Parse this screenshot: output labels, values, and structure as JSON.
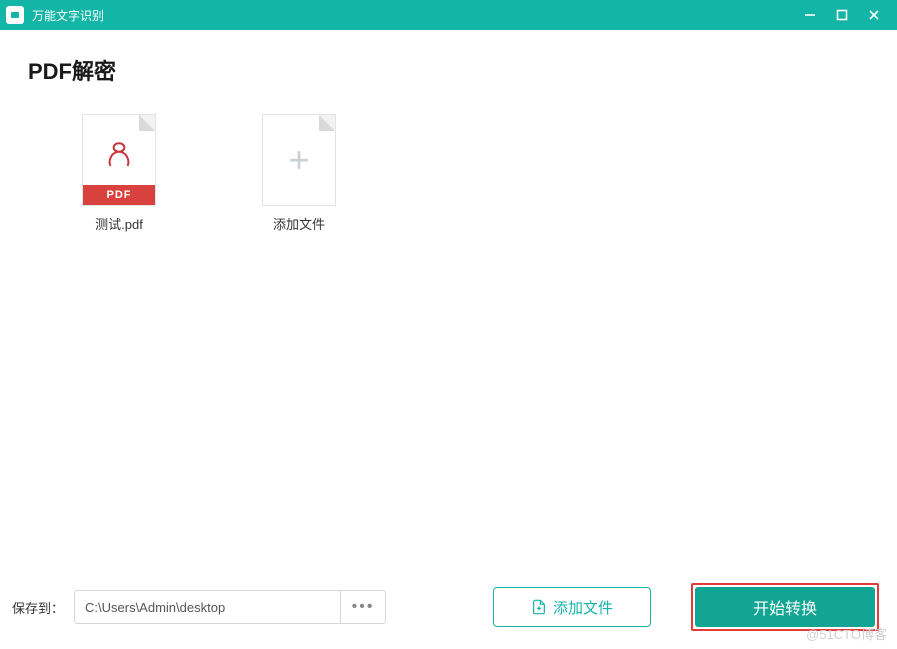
{
  "app": {
    "title": "万能文字识别"
  },
  "page": {
    "heading": "PDF解密"
  },
  "files": [
    {
      "name": "测试.pdf",
      "badge": "PDF"
    }
  ],
  "add_tile_label": "添加文件",
  "footer": {
    "save_to_label": "保存到：",
    "save_path": "C:\\Users\\Admin\\desktop",
    "browse_label": "•••",
    "add_file_button": "添加文件",
    "start_button": "开始转换"
  },
  "watermark": "@51CTO博客",
  "colors": {
    "accent": "#13b6a6",
    "highlight_border": "#e23b3b",
    "pdf_badge": "#d9413e"
  }
}
